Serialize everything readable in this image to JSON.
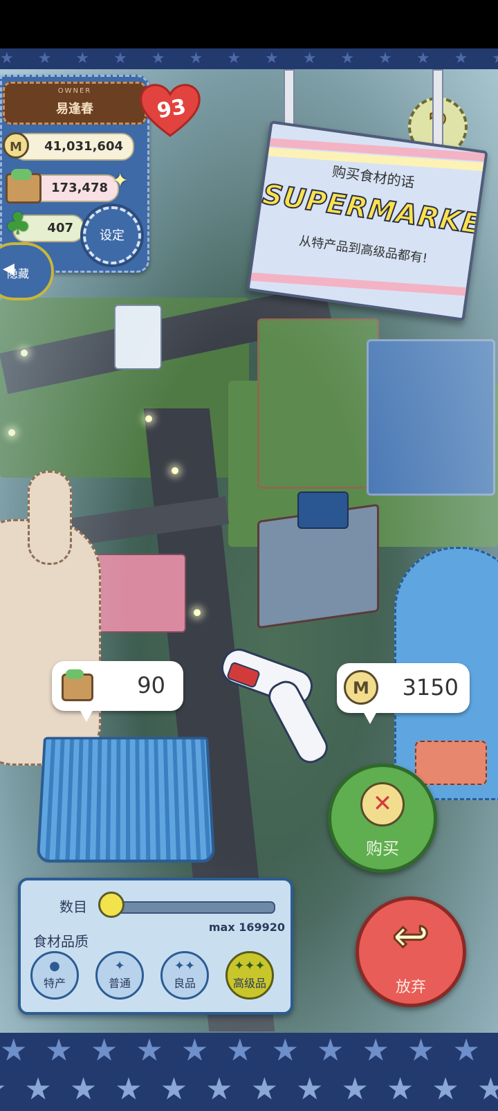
{
  "owner": {
    "badge_label": "OWNER",
    "name": "易逢春",
    "level": "93"
  },
  "stats": {
    "coins": "41,031,604",
    "coin_icon_letter": "M",
    "ingredients": "173,478",
    "clover": "407"
  },
  "buttons": {
    "settings": "设定",
    "hide": "隐藏",
    "help": "?",
    "buy": "购买",
    "abandon": "放弃"
  },
  "sign": {
    "line1": "购买食材的话",
    "title": "SUPERMARKET",
    "line2": "从特产品到高级品都有!"
  },
  "purchase": {
    "ingredient_amount": "90",
    "coin_cost": "3150"
  },
  "quantity": {
    "label": "数目",
    "max_label": "max 169920",
    "slider_fraction": 0.0
  },
  "quality": {
    "label": "食材品质",
    "options": [
      "特产",
      "普通",
      "良品",
      "高级品"
    ],
    "option_icons": [
      "●",
      "✦",
      "✦✦",
      "✦✦✦"
    ],
    "selected": "高级品"
  },
  "colors": {
    "buy_button": "#5fae4f",
    "abandon_button": "#e85d57",
    "selected_quality": "#c9c62c"
  }
}
